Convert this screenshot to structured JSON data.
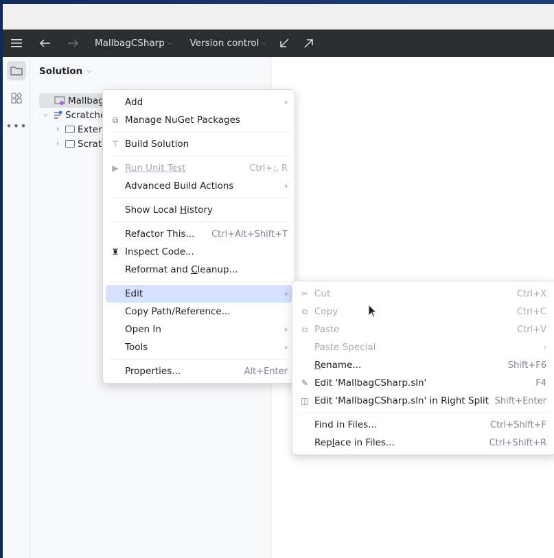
{
  "toolbar": {
    "project": "MallbagCSharp",
    "vcs": "Version control"
  },
  "panel": {
    "title": "Solution"
  },
  "tree": {
    "root": "MallbagC",
    "scratches": "Scratche",
    "external": "Exter",
    "scratch": "Scrat"
  },
  "context_menu": {
    "items": {
      "add": "Add",
      "nuget": "Manage NuGet Packages",
      "build": "Build Solution",
      "run_tests": "Run Unit Test",
      "run_tests_sc": "Ctrl+;, R",
      "adv_build": "Advanced Build Actions",
      "history_pre": "Show Local ",
      "history_u": "H",
      "history_post": "istory",
      "refactor": "Refactor This...",
      "refactor_sc": "Ctrl+Alt+Shift+T",
      "inspect": "Inspect Code...",
      "reformat_pre": "Reformat and ",
      "reformat_u": "C",
      "reformat_post": "leanup...",
      "edit": "Edit",
      "copy_path": "Copy Path/Reference...",
      "open_in": "Open In",
      "tools": "Tools",
      "properties": "Properties...",
      "properties_sc": "Alt+Enter"
    }
  },
  "edit_submenu": {
    "items": {
      "cut": "Cut",
      "cut_sc": "Ctrl+X",
      "copy": "Copy",
      "copy_sc": "Ctrl+C",
      "paste": "Paste",
      "paste_sc": "Ctrl+V",
      "paste_special": "Paste Special",
      "rename_u": "R",
      "rename_post": "ename...",
      "rename_sc": "Shift+F6",
      "edit_sln": "Edit 'MallbagCSharp.sln'",
      "edit_sln_sc": "F4",
      "edit_split": "Edit 'MallbagCSharp.sln' in Right Split",
      "edit_split_sc": "Shift+Enter",
      "find": "Find in Files...",
      "find_sc": "Ctrl+Shift+F",
      "replace_pre": "Rep",
      "replace_u": "l",
      "replace_post": "ace in Files...",
      "replace_sc": "Ctrl+Shift+R"
    }
  }
}
